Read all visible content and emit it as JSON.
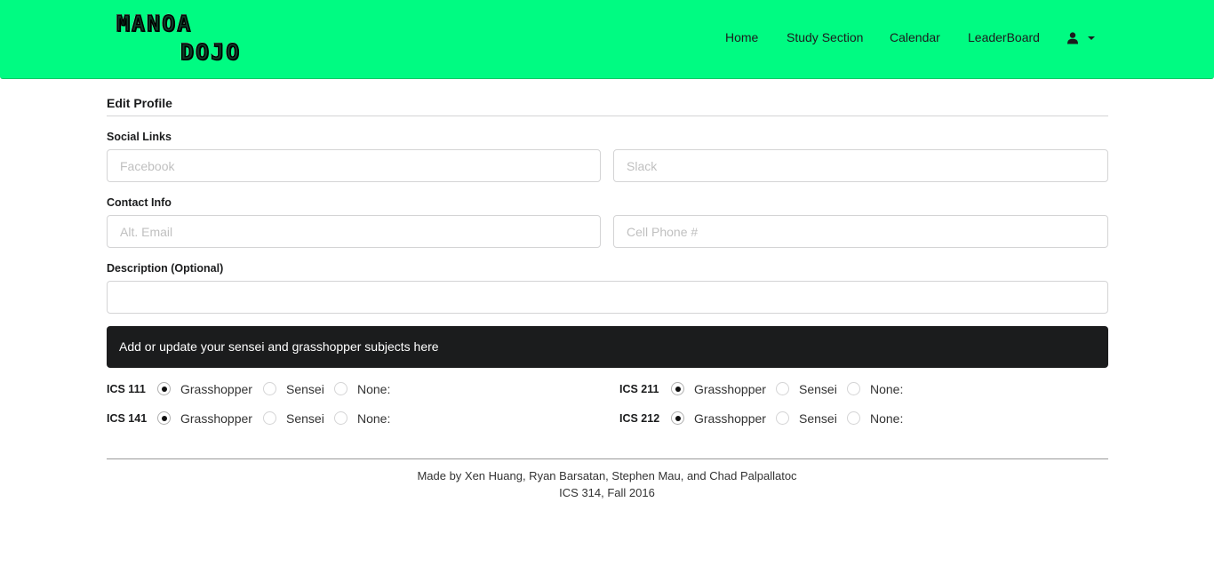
{
  "brand": {
    "logo_line_1": "MANOA",
    "logo_line_2": "DOJO",
    "nav_bg": "#00fb82"
  },
  "nav": {
    "items": [
      {
        "label": "Home"
      },
      {
        "label": "Study Section"
      },
      {
        "label": "Calendar"
      },
      {
        "label": "LeaderBoard"
      }
    ],
    "user_icon": "user-icon",
    "dropdown_icon": "caret-down-icon"
  },
  "form": {
    "title": "Edit Profile",
    "social_label": "Social Links",
    "facebook_placeholder": "Facebook",
    "slack_placeholder": "Slack",
    "contact_label": "Contact Info",
    "email_placeholder": "Alt. Email",
    "phone_placeholder": "Cell Phone #",
    "description_label": "Description (Optional)",
    "description_value": "",
    "banner_text": "Add or update your sensei and grasshopper subjects here"
  },
  "subjects": [
    {
      "code": "ICS 111",
      "options": [
        "Grasshopper",
        "Sensei",
        "None:"
      ],
      "selected": "Grasshopper"
    },
    {
      "code": "ICS 211",
      "options": [
        "Grasshopper",
        "Sensei",
        "None:"
      ],
      "selected": "Grasshopper"
    },
    {
      "code": "ICS 141",
      "options": [
        "Grasshopper",
        "Sensei",
        "None:"
      ],
      "selected": "Grasshopper"
    },
    {
      "code": "ICS 212",
      "options": [
        "Grasshopper",
        "Sensei",
        "None:"
      ],
      "selected": "Grasshopper"
    }
  ],
  "footer": {
    "credits": "Made by Xen Huang, Ryan Barsatan, Stephen Mau, and Chad Palpallatoc",
    "course": "ICS 314, Fall 2016"
  }
}
